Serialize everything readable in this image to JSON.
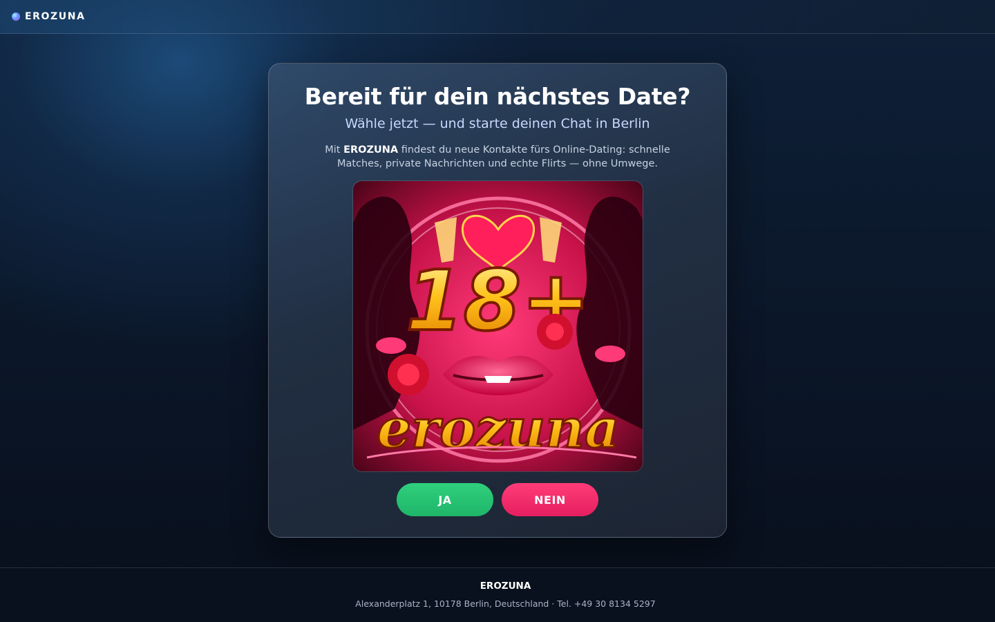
{
  "header": {
    "brand": "EROZUNA"
  },
  "card": {
    "title": "Bereit für dein nächstes Date?",
    "subtitle": "Wähle jetzt — und starte deinen Chat in Berlin",
    "desc_prefix": "Mit ",
    "desc_brand": "EROZUNA",
    "desc_suffix": " findest du neue Kontakte fürs Online-Dating: schnelle Matches, private Nachrichten und echte Flirts — ohne Umwege.",
    "hero_badge": "18+",
    "hero_wordmark": "erozuna",
    "yes_label": "JA",
    "no_label": "NEIN"
  },
  "footer": {
    "brand": "EROZUNA",
    "address": "Alexanderplatz 1, 10178 Berlin, Deutschland · Tel. +49 30 8134 5297"
  },
  "colors": {
    "yes_button": "#22c16f",
    "no_button": "#f02a68",
    "hero_red": "#d0104a"
  },
  "icons": [
    "logo-dot-icon"
  ]
}
